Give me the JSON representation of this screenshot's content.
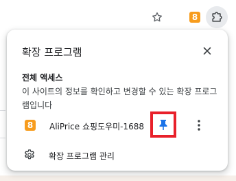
{
  "toolbar": {
    "extension_badge_text": "8",
    "icons": [
      "star-icon",
      "extension-badge-icon",
      "puzzle-icon"
    ]
  },
  "popup": {
    "title": "확장 프로그램",
    "close_icon": "close-icon",
    "full_access": {
      "heading": "전체 액세스",
      "description": "이 사이트의 정보를 확인하고 변경할 수 있는 확장 프로그램입니다"
    },
    "extensions": [
      {
        "icon_text": "8",
        "name": "AliPrice 쇼핑도우미-1688",
        "pinned": true
      }
    ],
    "manage_label": "확장 프로그램 관리"
  },
  "colors": {
    "badge": "#f79c1d",
    "pin": "#1a73e8",
    "highlight": "#e8202a",
    "text": "#202124"
  }
}
